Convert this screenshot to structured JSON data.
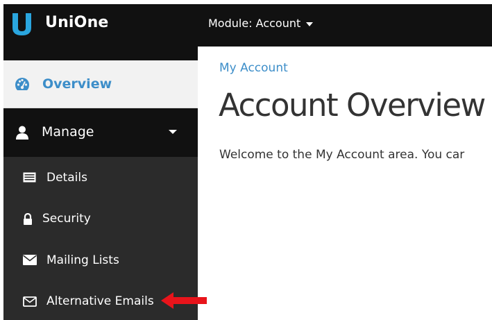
{
  "app": {
    "brand_name": "UniOne",
    "module_label": "Module: Account"
  },
  "sidebar": {
    "overview": {
      "label": "Overview",
      "icon": "dashboard-icon"
    },
    "manage": {
      "label": "Manage",
      "icon": "user-icon"
    },
    "sub_items": [
      {
        "label": "Details",
        "icon": "id-card-icon"
      },
      {
        "label": "Security",
        "icon": "lock-icon"
      },
      {
        "label": "Mailing Lists",
        "icon": "envelope-icon"
      },
      {
        "label": "Alternative Emails",
        "icon": "envelope-outline-icon"
      }
    ]
  },
  "main": {
    "breadcrumb": "My Account",
    "title": "Account Overview",
    "welcome_text": "Welcome to the My Account area. You car"
  },
  "colors": {
    "accent": "#3d8ec9",
    "topbar": "#111111",
    "sidebar": "#2b2b2b",
    "annotation_arrow": "#e8141b"
  }
}
